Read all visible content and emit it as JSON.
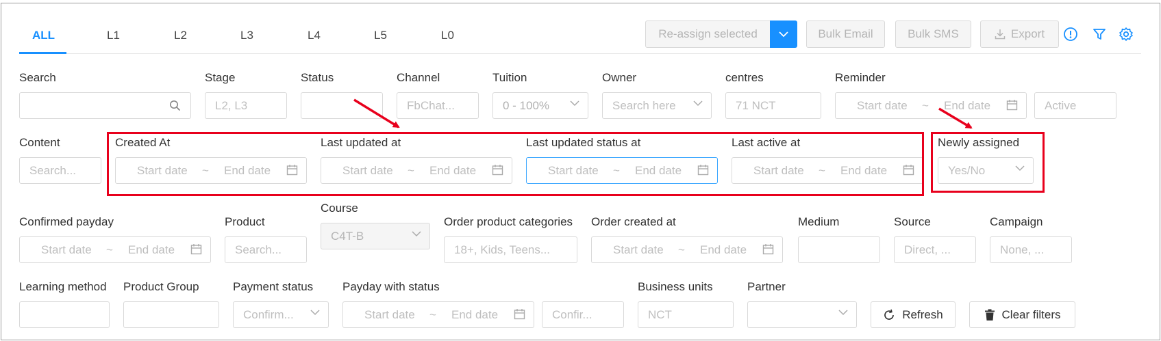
{
  "tabs": [
    "ALL",
    "L1",
    "L2",
    "L3",
    "L4",
    "L5",
    "L0"
  ],
  "toolbar": {
    "reassign": "Re-assign selected",
    "bulk_email": "Bulk Email",
    "bulk_sms": "Bulk SMS",
    "export": "Export"
  },
  "row1": {
    "search": {
      "label": "Search",
      "value": ""
    },
    "stage": {
      "label": "Stage",
      "placeholder": "L2, L3"
    },
    "status": {
      "label": "Status",
      "placeholder": ""
    },
    "channel": {
      "label": "Channel",
      "placeholder": "FbChat..."
    },
    "tuition": {
      "label": "Tuition",
      "value": "0 - 100%"
    },
    "owner": {
      "label": "Owner",
      "placeholder": "Search here"
    },
    "centres": {
      "label": "centres",
      "value": "71 NCT"
    },
    "reminder": {
      "label": "Reminder",
      "start": "Start date",
      "sep": "~",
      "end": "End date"
    },
    "active": {
      "placeholder": "Active"
    }
  },
  "row2": {
    "content": {
      "label": "Content",
      "placeholder": "Search..."
    },
    "created_at": {
      "label": "Created At",
      "start": "Start date",
      "sep": "~",
      "end": "End date"
    },
    "last_updated": {
      "label": "Last updated at",
      "start": "Start date",
      "sep": "~",
      "end": "End date"
    },
    "last_updated_status": {
      "label": "Last updated status at",
      "start": "Start date",
      "sep": "~",
      "end": "End date"
    },
    "last_active": {
      "label": "Last active at",
      "start": "Start date",
      "sep": "~",
      "end": "End date"
    },
    "newly_assigned": {
      "label": "Newly assigned",
      "placeholder": "Yes/No"
    }
  },
  "row3": {
    "confirmed_payday": {
      "label": "Confirmed payday",
      "start": "Start date",
      "sep": "~",
      "end": "End date"
    },
    "product": {
      "label": "Product",
      "placeholder": "Search..."
    },
    "course": {
      "label": "Course",
      "value": "C4T-B"
    },
    "order_product_categories": {
      "label": "Order product categories",
      "placeholder": "18+, Kids, Teens..."
    },
    "order_created_at": {
      "label": "Order created at",
      "start": "Start date",
      "sep": "~",
      "end": "End date"
    },
    "medium": {
      "label": "Medium",
      "placeholder": ""
    },
    "source": {
      "label": "Source",
      "placeholder": "Direct, ..."
    },
    "campaign": {
      "label": "Campaign",
      "placeholder": "None, ..."
    }
  },
  "row4": {
    "learning_method": {
      "label": "Learning method",
      "placeholder": ""
    },
    "product_group": {
      "label": "Product Group",
      "placeholder": ""
    },
    "payment_status": {
      "label": "Payment status",
      "placeholder": "Confirm..."
    },
    "payday_with_status": {
      "label": "Payday with status",
      "start": "Start date",
      "sep": "~",
      "end": "End date",
      "status_placeholder": "Confir..."
    },
    "business_units": {
      "label": "Business units",
      "value": "NCT"
    },
    "partner": {
      "label": "Partner",
      "value": ""
    },
    "refresh": "Refresh",
    "clear_filters": "Clear filters"
  },
  "colors": {
    "accent": "#1890ff",
    "annotation": "#e8001c",
    "border": "#d9d9d9",
    "placeholder": "#bfbfbf"
  }
}
